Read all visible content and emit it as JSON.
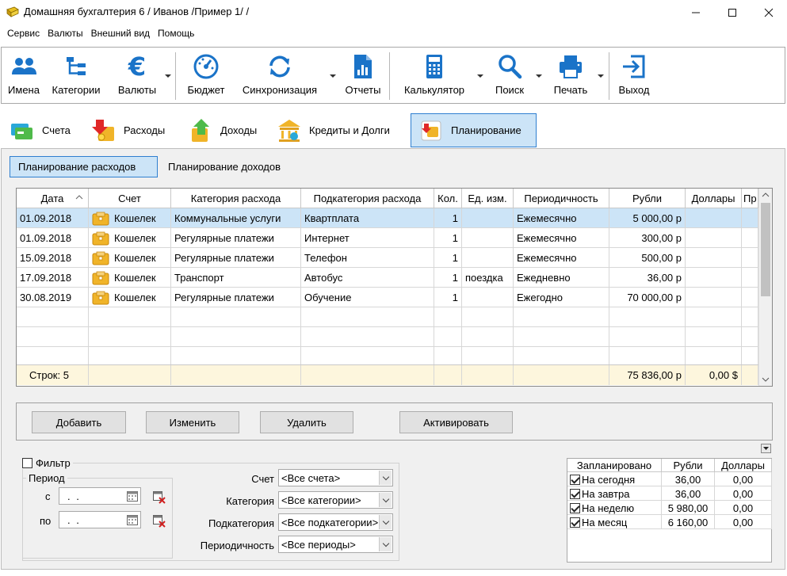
{
  "window": {
    "title": "Домашняя бухгалтерия 6  / Иванов /Пример 1/ /"
  },
  "menu": [
    "Сервис",
    "Валюты",
    "Внешний вид",
    "Помощь"
  ],
  "toolbar": [
    {
      "label": "Имена",
      "icon": "users-icon"
    },
    {
      "label": "Категории",
      "icon": "categories-icon"
    },
    {
      "label": "Валюты",
      "icon": "euro-icon"
    },
    {
      "label": "Бюджет",
      "icon": "gauge-icon"
    },
    {
      "label": "Синхронизация",
      "icon": "sync-icon"
    },
    {
      "label": "Отчеты",
      "icon": "report-icon"
    },
    {
      "label": "Калькулятор",
      "icon": "calculator-icon"
    },
    {
      "label": "Поиск",
      "icon": "search-icon"
    },
    {
      "label": "Печать",
      "icon": "printer-icon"
    },
    {
      "label": "Выход",
      "icon": "exit-icon"
    }
  ],
  "tabs": [
    {
      "label": "Счета"
    },
    {
      "label": "Расходы"
    },
    {
      "label": "Доходы"
    },
    {
      "label": "Кредиты и Долги"
    },
    {
      "label": "Планирование",
      "active": true
    }
  ],
  "subtabs": [
    {
      "label": "Планирование расходов",
      "active": true
    },
    {
      "label": "Планирование доходов"
    }
  ],
  "table": {
    "columns": [
      "Дата",
      "Счет",
      "Категория расхода",
      "Подкатегория расхода",
      "Кол.",
      "Ед. изм.",
      "Периодичность",
      "Рубли",
      "Доллары",
      "Пр"
    ],
    "rows": [
      {
        "date": "01.09.2018",
        "account": "Кошелек",
        "category": "Коммунальные услуги",
        "subcategory": "Квартплата",
        "qty": "1",
        "unit": "",
        "period": "Ежемесячно",
        "rub": "5 000,00 р",
        "usd": ""
      },
      {
        "date": "01.09.2018",
        "account": "Кошелек",
        "category": "Регулярные платежи",
        "subcategory": "Интернет",
        "qty": "1",
        "unit": "",
        "period": "Ежемесячно",
        "rub": "300,00 р",
        "usd": ""
      },
      {
        "date": "15.09.2018",
        "account": "Кошелек",
        "category": "Регулярные платежи",
        "subcategory": "Телефон",
        "qty": "1",
        "unit": "",
        "period": "Ежемесячно",
        "rub": "500,00 р",
        "usd": ""
      },
      {
        "date": "17.09.2018",
        "account": "Кошелек",
        "category": "Транспорт",
        "subcategory": "Автобус",
        "qty": "1",
        "unit": "поездка",
        "period": "Ежедневно",
        "rub": "36,00 р",
        "usd": ""
      },
      {
        "date": "30.08.2019",
        "account": "Кошелек",
        "category": "Регулярные платежи",
        "subcategory": "Обучение",
        "qty": "1",
        "unit": "",
        "period": "Ежегодно",
        "rub": "70 000,00 р",
        "usd": ""
      }
    ],
    "footer": {
      "count": "Строк: 5",
      "rub_total": "75 836,00 р",
      "usd_total": "0,00 $"
    }
  },
  "buttons": {
    "add": "Добавить",
    "edit": "Изменить",
    "delete": "Удалить",
    "activate": "Активировать"
  },
  "filter": {
    "label": "Фильтр",
    "period_label": "Период",
    "from_label": "с",
    "to_label": "по",
    "from_value": " .  .",
    "to_value": " .  .",
    "account_label": "Счет",
    "account_value": "<Все счета>",
    "category_label": "Категория",
    "category_value": "<Все категории>",
    "subcategory_label": "Подкатегория",
    "subcategory_value": "<Все подкатегории>",
    "periodicity_label": "Периодичность",
    "periodicity_value": "<Все периоды>"
  },
  "summary": {
    "columns": [
      "Запланировано",
      "Рубли",
      "Доллары"
    ],
    "rows": [
      {
        "label": "На сегодня",
        "rub": "36,00",
        "usd": "0,00"
      },
      {
        "label": "На завтра",
        "rub": "36,00",
        "usd": "0,00"
      },
      {
        "label": "На неделю",
        "rub": "5 980,00",
        "usd": "0,00"
      },
      {
        "label": "На месяц",
        "rub": "6 160,00",
        "usd": "0,00"
      }
    ]
  },
  "colors": {
    "accent": "#1a73c8",
    "selection": "#cce4f7",
    "footer": "#fdf6dd"
  }
}
